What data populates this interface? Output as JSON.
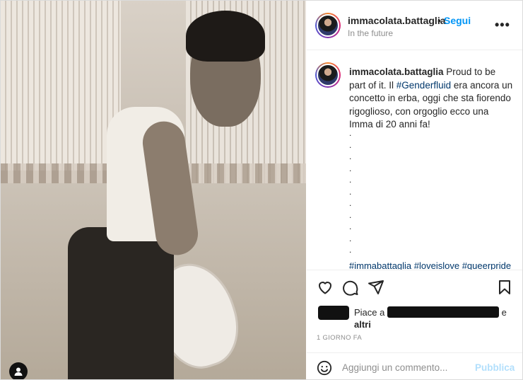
{
  "post": {
    "username": "immacolata.battaglia",
    "separator": "•",
    "follow_label": "Segui",
    "location": "In the future",
    "more_label": "•••"
  },
  "caption": {
    "username": "immacolata.battaglia",
    "text_before": " Proud to be part of it. Il ",
    "hashtag": "#Genderfluid",
    "text_after": " era ancora un concetto in erba, oggi che sta fiorendo rigoglioso, con orgoglio ecco una Imma di 20 anni fa!",
    "dots": [
      ".",
      ".",
      ".",
      ".",
      ".",
      ".",
      ".",
      ".",
      ".",
      ".",
      ".",
      "."
    ],
    "tags": "#immabattaglia #loveislove #queerpride"
  },
  "actions": {
    "like_icon": "heart-icon",
    "comment_icon": "comment-icon",
    "share_icon": "paper-plane-icon",
    "save_icon": "bookmark-icon"
  },
  "likes": {
    "prefix": "Piace a",
    "suffix": "e",
    "others": "altri"
  },
  "timestamp": "1 GIORNO FA",
  "comment_box": {
    "placeholder": "Aggiungi un commento...",
    "post_label": "Pubblica",
    "emoji_icon": "smiley-icon"
  },
  "colors": {
    "accent": "#0095f6",
    "post_disabled": "#b2dffc",
    "secondary_text": "#8e8e8e",
    "hashtag": "#00376b"
  }
}
